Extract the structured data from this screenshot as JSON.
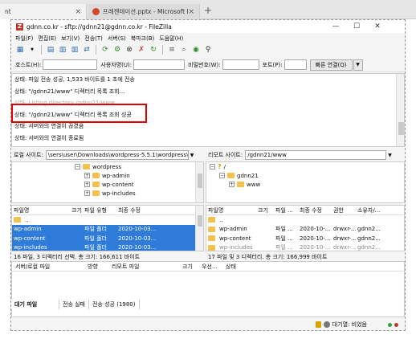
{
  "browser": {
    "tab1_label": "nt",
    "tab2_label": "프레젠테이션.pptx - Microsoft P",
    "close_glyph": "×",
    "new_tab_glyph": "+"
  },
  "window": {
    "title": "gdnn.co.kr - sftp://gdnn21@gdnn.co.kr - FileZilla",
    "logo_letter": "Z",
    "minimize": "—",
    "maximize": "☐",
    "close": "✕"
  },
  "menu": [
    "파일(F)",
    "편집(E)",
    "보기(V)",
    "전송(T)",
    "서버(S)",
    "북마크(B)",
    "도움말(H)"
  ],
  "quickconnect": {
    "host_label": "호스트(H):",
    "user_label": "사용자명(U):",
    "pass_label": "비밀번호(W):",
    "port_label": "포트(P):",
    "connect_button": "빠른 연결(Q)",
    "dropdown_glyph": "▼"
  },
  "log": [
    "상태:  파일 전송 성공, 1,533 바이트를 1 초에 전송",
    "상태:  \"/gdnn21/www\" 디렉터리 목록 조회...",
    "상태:  Listing directory /gdnn21/www",
    "상태:  \"/gdnn21/www\" 디렉터리 목록 조회 성공",
    "상태:  서버와의 연결이 끊겼음",
    "상태:  서버와의 연결이 종료됨"
  ],
  "local": {
    "site_label": "로컬 사이트:",
    "site_path": "\\sers\\user\\Downloads\\wordpress-5.5.1\\wordpress\\",
    "tree": [
      {
        "label": "wordpress",
        "indent": 0,
        "expander": "−"
      },
      {
        "label": "wp-admin",
        "indent": 1,
        "expander": "+"
      },
      {
        "label": "wp-content",
        "indent": 1,
        "expander": "+"
      },
      {
        "label": "wp-includes",
        "indent": 1,
        "expander": "+"
      }
    ],
    "columns": [
      "파일명",
      "크기",
      "파일 유형",
      "최종 수정"
    ],
    "rows": [
      {
        "name": "..",
        "size": "",
        "type": "",
        "modified": "",
        "selected": false
      },
      {
        "name": "wp-admin",
        "size": "",
        "type": "파일 폴더",
        "modified": "2020-10-03...",
        "selected": true
      },
      {
        "name": "wp-content",
        "size": "",
        "type": "파일 폴더",
        "modified": "2020-10-03...",
        "selected": true
      },
      {
        "name": "wp-includes",
        "size": "",
        "type": "파일 폴더",
        "modified": "2020-10-03...",
        "selected": true
      }
    ],
    "status": "16 파일, 3 디렉터리 선택. 총 크기: 166,611 바이트"
  },
  "remote": {
    "site_label": "리모트 사이트:",
    "site_path": "/gdnn21/www",
    "tree": [
      {
        "label": "/",
        "indent": 0,
        "expander": "−",
        "question": true
      },
      {
        "label": "gdnn21",
        "indent": 1,
        "expander": "−"
      },
      {
        "label": "www",
        "indent": 2,
        "expander": "+"
      }
    ],
    "columns": [
      "파일명",
      "크기",
      "파일 ...",
      "최종 수정",
      "권한",
      "소유자/..."
    ],
    "rows": [
      {
        "name": "..",
        "size": "",
        "type": "",
        "modified": "",
        "perm": "",
        "owner": ""
      },
      {
        "name": "wp-admin",
        "size": "",
        "type": "파일 ...",
        "modified": "2020-10-...",
        "perm": "drwxr-...",
        "owner": "gdnn2..."
      },
      {
        "name": "wp-content",
        "size": "",
        "type": "파일 ...",
        "modified": "2020-10-...",
        "perm": "drwxr-...",
        "owner": "gdnn2..."
      },
      {
        "name": "wp-includes",
        "size": "",
        "type": "파일 ...",
        "modified": "2020-10-...",
        "perm": "drwxr-...",
        "owner": "gdnn2..."
      }
    ],
    "status": "17 파일 및 3 디렉터리. 총 크기: 166,999 바이트"
  },
  "queue": {
    "columns": [
      "서버/로컬 파일",
      "방향",
      "리모트 파일",
      "크기",
      "우선...",
      "상태"
    ],
    "tabs": [
      "대기 파일",
      "전송 실패",
      "전송 성공 (1980)"
    ]
  },
  "statusbar": {
    "queue_label": "대기열: 비었음"
  },
  "colors": {
    "selection": "#2f7bd9",
    "highlight_box": "#e00000",
    "folder": "#f2c14e"
  }
}
